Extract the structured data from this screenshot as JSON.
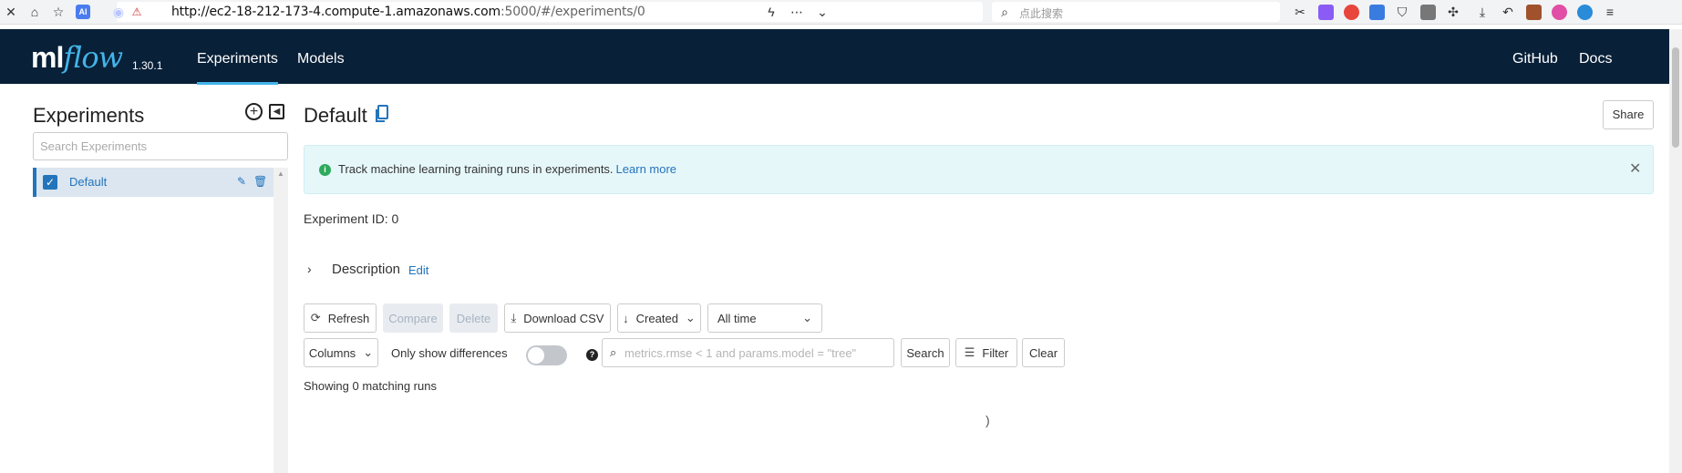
{
  "browser": {
    "url_main": "http://ec2-18-212-173-4.compute-1.amazonaws.com",
    "url_rest": ":5000/#/experiments/0",
    "search_placeholder": "点此搜索"
  },
  "header": {
    "logo_ml": "ml",
    "logo_flow": "flow",
    "version": "1.30.1",
    "nav": [
      {
        "label": "Experiments",
        "active": true
      },
      {
        "label": "Models",
        "active": false
      }
    ],
    "right_links": [
      "GitHub",
      "Docs"
    ]
  },
  "sidebar": {
    "title": "Experiments",
    "search_placeholder": "Search Experiments",
    "experiments": [
      {
        "name": "Default",
        "selected": true
      }
    ]
  },
  "main": {
    "title": "Default",
    "share_label": "Share",
    "alert": {
      "text": "Track machine learning training runs in experiments.",
      "link": "Learn more"
    },
    "experiment_id_label": "Experiment ID:",
    "experiment_id": "0",
    "description_label": "Description",
    "description_edit": "Edit",
    "toolbar": {
      "refresh": "Refresh",
      "compare": "Compare",
      "delete": "Delete",
      "download_csv": "Download CSV",
      "sort": "Created",
      "time_range": "All time"
    },
    "filter_bar": {
      "columns": "Columns",
      "only_show_differences": "Only show differences",
      "search_placeholder": "metrics.rmse < 1 and params.model = \"tree\"",
      "search_button": "Search",
      "filter_button": "Filter",
      "clear_button": "Clear"
    },
    "runs_count_text": "Showing 0 matching runs"
  },
  "colors": {
    "header_bg": "#082038",
    "accent": "#43b4e8",
    "link": "#2374bb",
    "alert_bg": "#e6f7fa",
    "info_icon": "#2eaa5c"
  }
}
